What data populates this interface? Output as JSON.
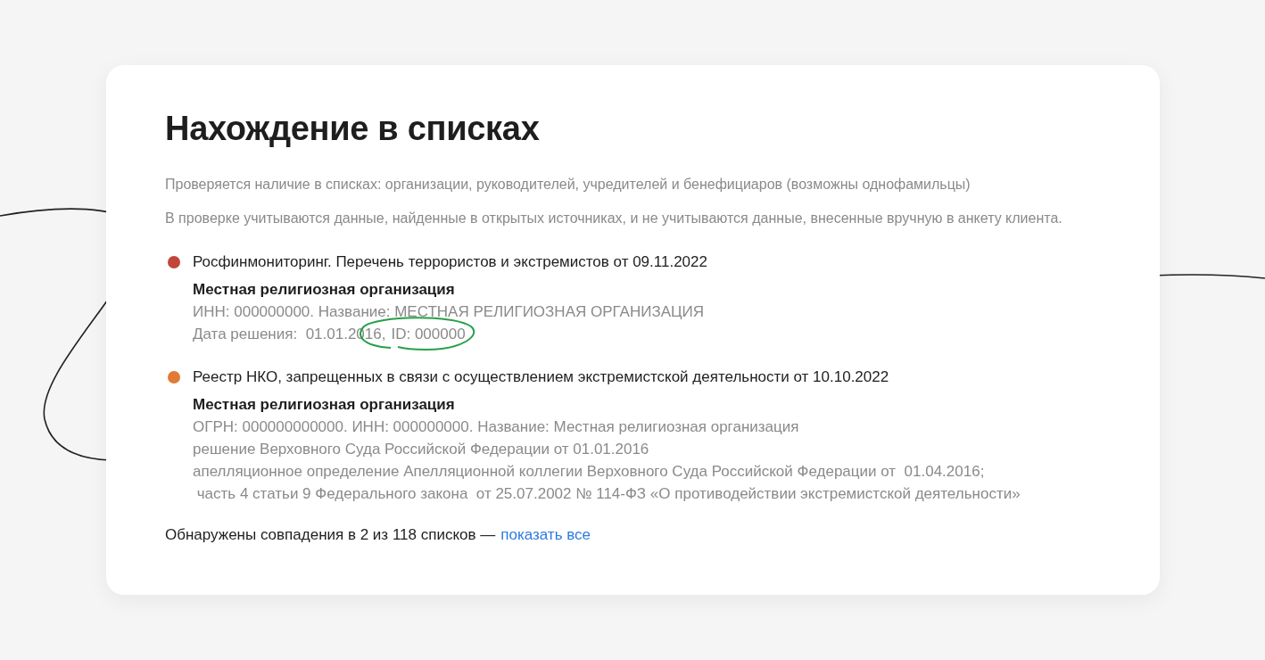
{
  "title": "Нахождение в списках",
  "notes": [
    "Проверяется наличие в списках: организации, руководителей, учредителей и бенефициаров (возможны однофамильцы)",
    "В проверке учитываются данные, найденные в открытых источниках, и не учитываются данные, внесенные вручную в анкету клиента."
  ],
  "matches": [
    {
      "list": "Росфинмониторинг. Перечень террористов и экстремистов от 09.11.2022",
      "color": "#c0463a",
      "organization": "Местная религиозная организация",
      "details": [
        {
          "text": "ИНН: 000000000. Название: МЕСТНАЯ РЕЛИГИОЗНАЯ ОРГАНИЗАЦИЯ"
        },
        {
          "text": "Дата решения:  01.01.2016,",
          "circled_text": "ID: 000000"
        }
      ]
    },
    {
      "list": "Реестр НКО, запрещенных в связи с осуществлением экстремистской деятельности от 10.10.2022",
      "color": "#e07a34",
      "organization": "Местная религиозная организация",
      "details": [
        {
          "text": "ОГРН: 000000000000. ИНН: 000000000. Название: Местная религиозная организация"
        },
        {
          "text": "решение Верховного Суда Российской Федерации от 01.01.2016"
        },
        {
          "text": "апелляционное определение Апелляционной коллегии Верховного Суда Российской Федерации от  01.04.2016;"
        },
        {
          "text": " часть 4 статьи 9 Федерального закона  от 25.07.2002 № 114-ФЗ «О противодействии экстремистской деятельности»"
        }
      ]
    }
  ],
  "summary": {
    "text": "Обнаружены совпадения в 2 из 118 списков —",
    "link": "показать все"
  }
}
